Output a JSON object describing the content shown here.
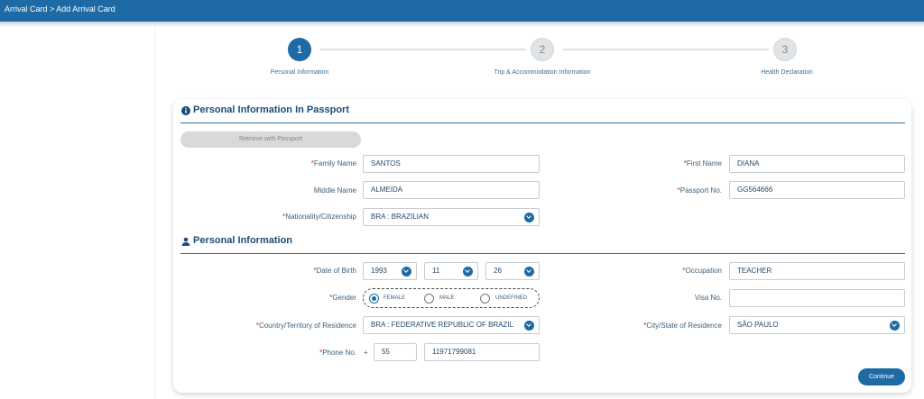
{
  "breadcrumb": "Arrival Card > Add Arrival Card",
  "steps": [
    {
      "number": "1",
      "label": "Personal Information",
      "state": "active"
    },
    {
      "number": "2",
      "label": "Trip & Accommodation Information",
      "state": "inactive"
    },
    {
      "number": "3",
      "label": "Health Declaration",
      "state": "inactive"
    }
  ],
  "passport_section": {
    "title": "Personal Information In Passport",
    "icon": "info-circle-icon",
    "retrieve_button": "Retrieve with Passport",
    "family_name": {
      "label": "Family Name",
      "value": "SANTOS",
      "required": true
    },
    "first_name": {
      "label": "First Name",
      "value": "DIANA",
      "required": true
    },
    "middle_name": {
      "label": "Middle Name",
      "value": "ALMEIDA",
      "required": false
    },
    "passport_no": {
      "label": "Passport No.",
      "value": "GG564666",
      "required": true
    },
    "nationality": {
      "label": "Nationality/Citizenship",
      "value": "BRA : BRAZILIAN",
      "required": true
    }
  },
  "personal_section": {
    "title": "Personal Information",
    "icon": "person-icon",
    "dob": {
      "label": "Date of Birth",
      "year": "1993",
      "month": "11",
      "day": "26",
      "required": true
    },
    "occupation": {
      "label": "Occupation",
      "value": "TEACHER",
      "required": true
    },
    "gender": {
      "label": "Gender",
      "options": [
        "FEMALE",
        "MALE",
        "UNDEFINED"
      ],
      "selected": "FEMALE",
      "required": true
    },
    "visa_no": {
      "label": "Visa No.",
      "value": "",
      "required": false
    },
    "country_residence": {
      "label": "Country/Territory of Residence",
      "value": "BRA : FEDERATIVE REPUBLIC OF BRAZIL",
      "required": true
    },
    "city_residence": {
      "label": "City/State of Residence",
      "value": "SÃO PAULO",
      "required": true
    },
    "phone": {
      "label": "Phone No.",
      "plus": "+",
      "code": "55",
      "number": "11971799081",
      "required": true
    }
  },
  "continue_button": "Continue",
  "colors": {
    "primary": "#1d6aa5",
    "required": "#d9222a",
    "inactive_step": "#e1e4e7"
  }
}
